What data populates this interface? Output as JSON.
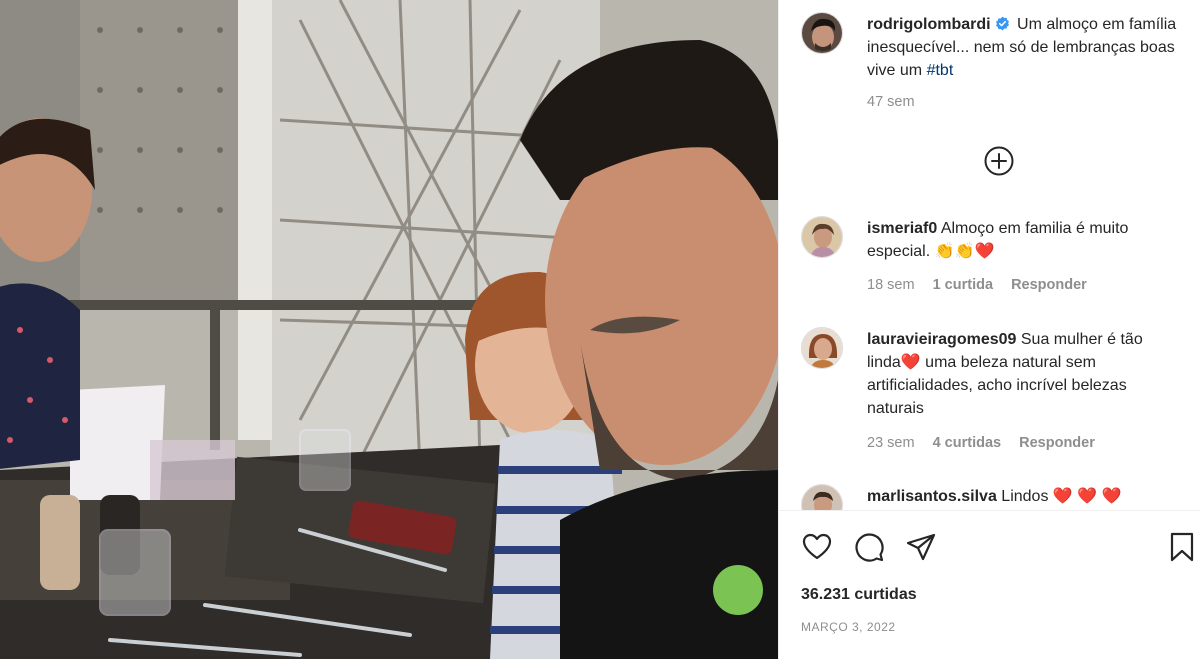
{
  "post": {
    "username": "rodrigolombardi",
    "caption_text": "Um almoço em família inesquecível... nem só de lembranças boas vive um",
    "caption_tag": "#tbt",
    "age": "47 sem"
  },
  "comments": [
    {
      "username": "ismeriaf0",
      "text": "Almoço em familia é muito especial.",
      "emoji": "👏👏❤️",
      "age": "18 sem",
      "likes": "1 curtida",
      "reply": "Responder"
    },
    {
      "username": "lauravieiragomes09",
      "text_before": "Sua mulher é tão linda",
      "emoji": "❤️",
      "text_after": " uma beleza natural sem artificialidades, acho incrível belezas naturais",
      "age": "23 sem",
      "likes": "4 curtidas",
      "reply": "Responder"
    },
    {
      "username": "marlisantos.silva",
      "text": "Lindos",
      "emoji": "❤️ ❤️ ❤️"
    }
  ],
  "footer": {
    "likes": "36.231 curtidas",
    "date": "MARÇO 3, 2022"
  },
  "icons": {
    "like": "heart-outline-icon",
    "comment": "speech-bubble-icon",
    "share": "paper-plane-icon",
    "save": "bookmark-icon",
    "load_more": "plus-circle-icon",
    "verified": "verified-badge-icon"
  },
  "colors": {
    "verified": "#3897f0",
    "link": "#00376b",
    "muted": "#8e8e8e",
    "text": "#262626"
  }
}
